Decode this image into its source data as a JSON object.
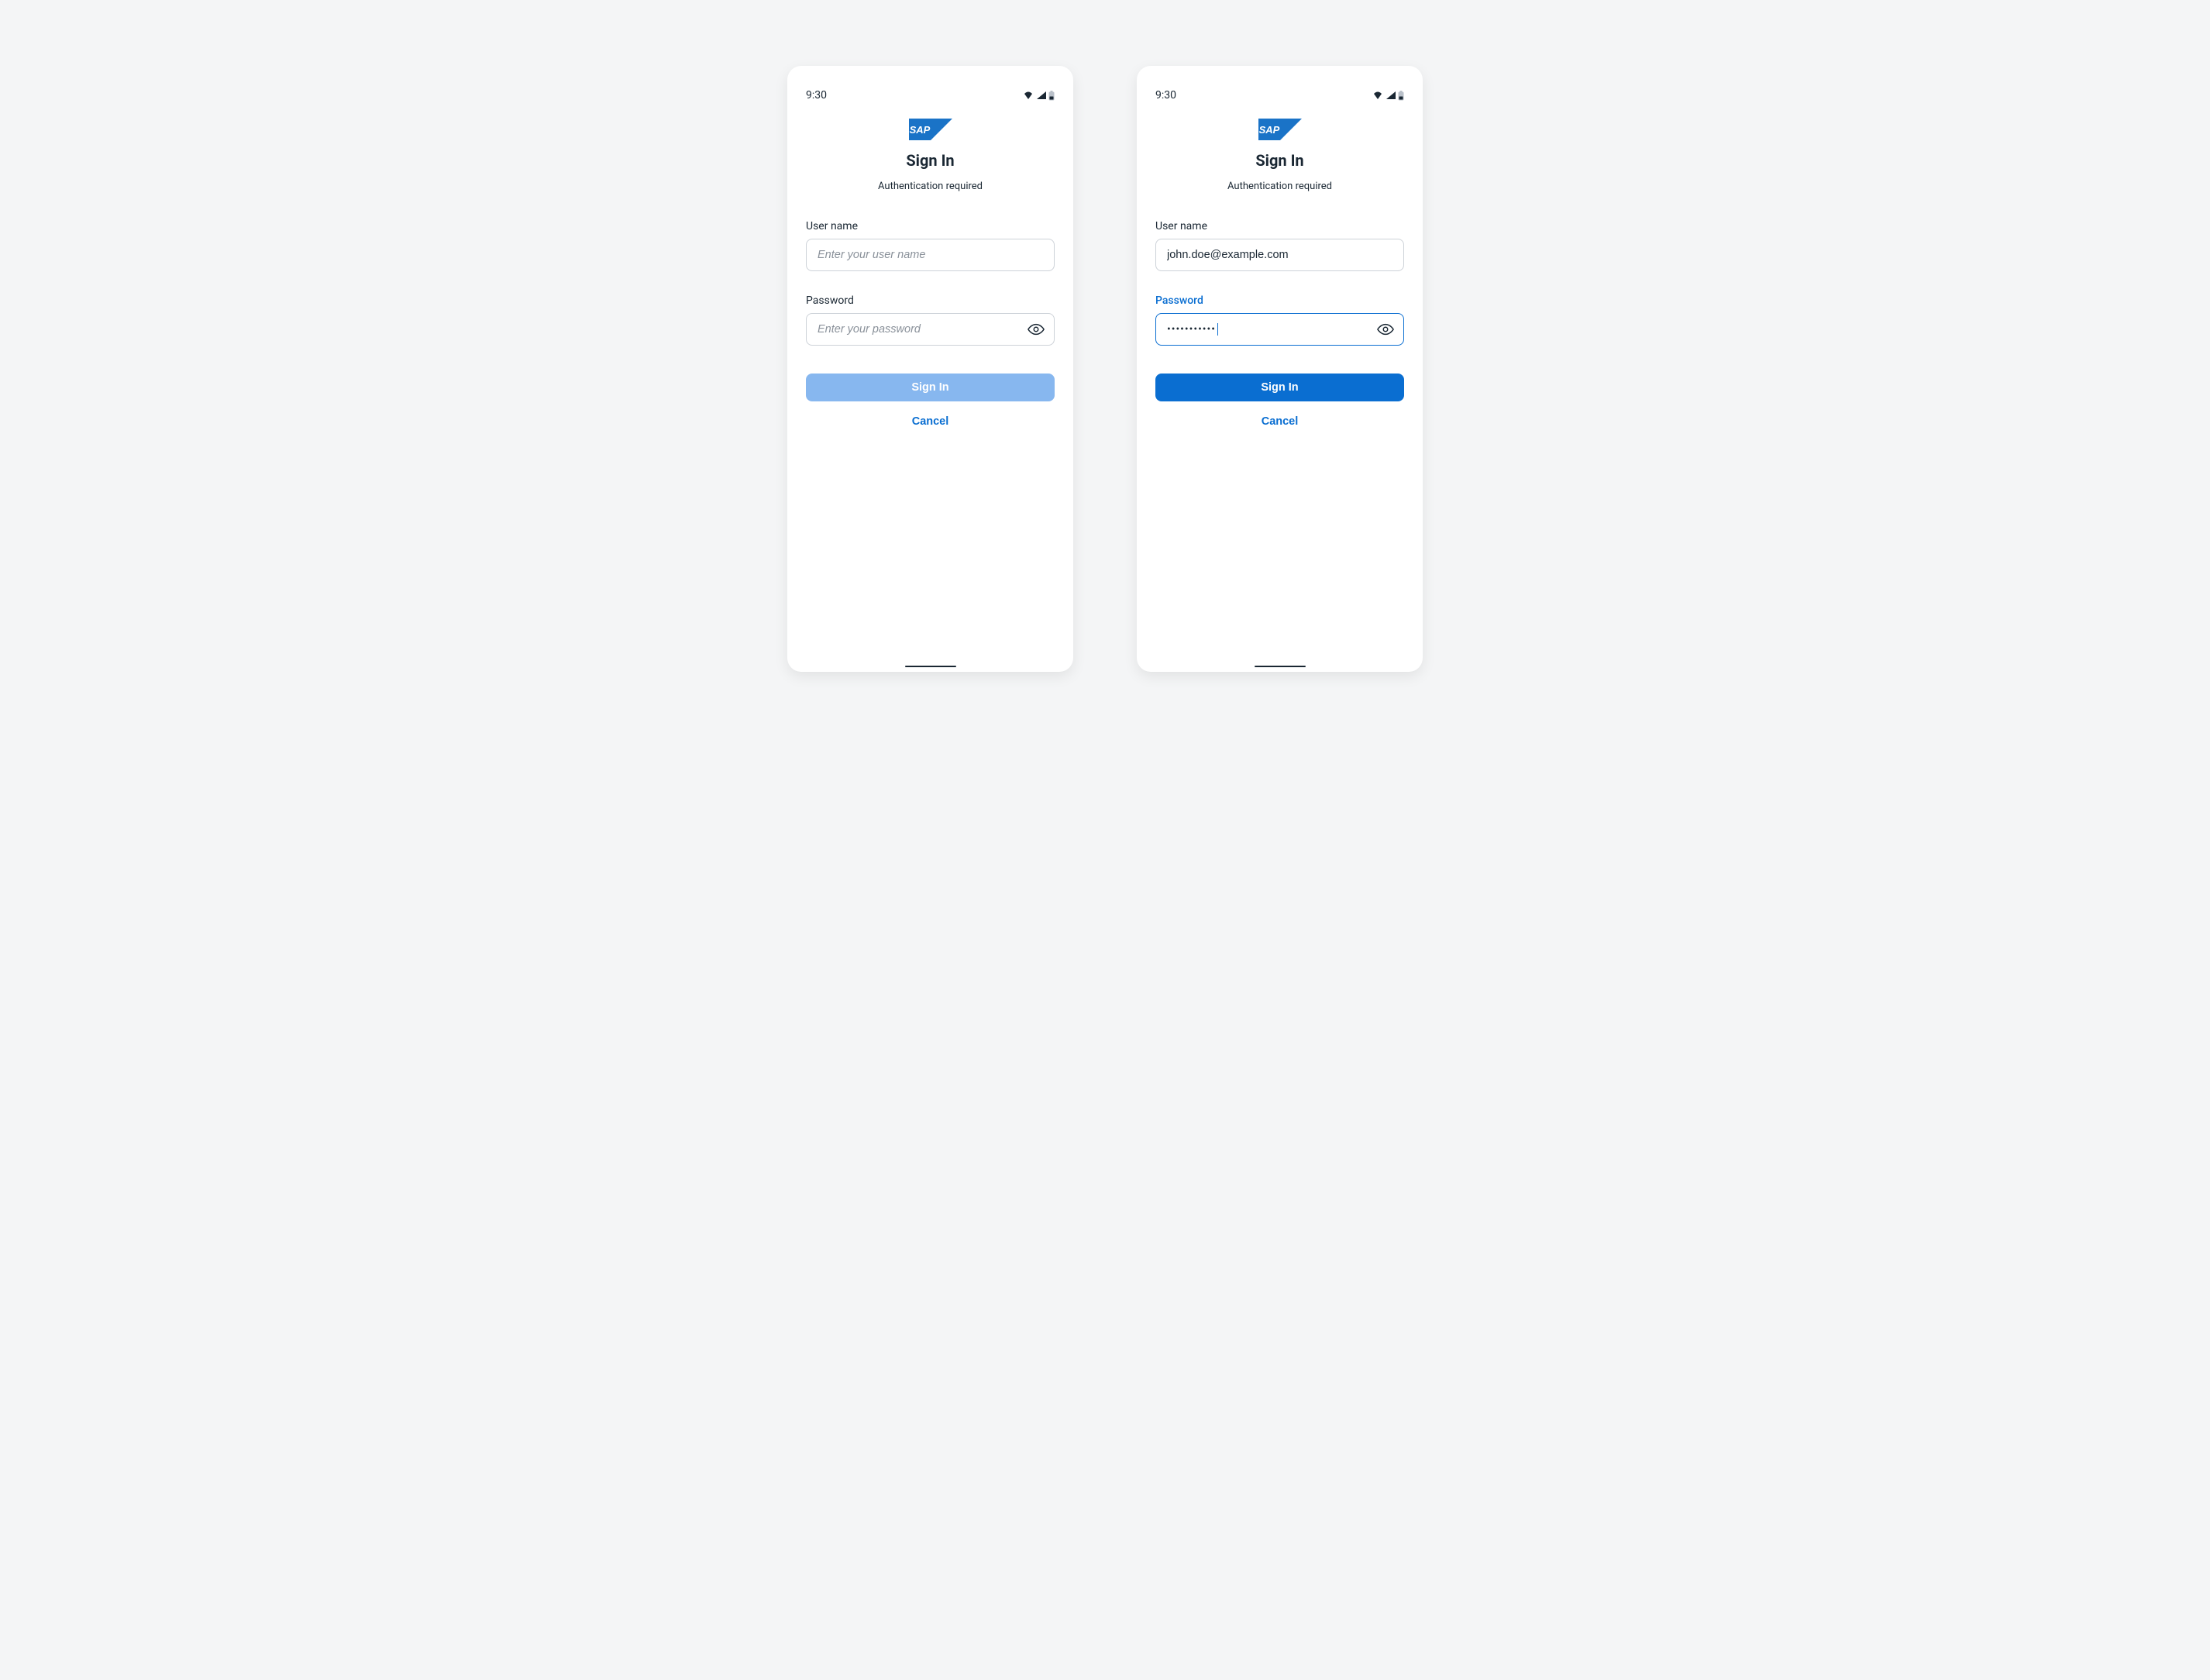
{
  "status": {
    "time": "9:30"
  },
  "screen1": {
    "title": "Sign In",
    "subtitle": "Authentication required",
    "username_label": "User name",
    "username_placeholder": "Enter your user name",
    "username_value": "",
    "password_label": "Password",
    "password_placeholder": "Enter your password",
    "password_value": "",
    "signin_button": "Sign In",
    "cancel_button": "Cancel"
  },
  "screen2": {
    "title": "Sign In",
    "subtitle": "Authentication required",
    "username_label": "User name",
    "username_value": "john.doe@example.com",
    "password_label": "Password",
    "password_masked": "•••••••••••",
    "signin_button": "Sign In",
    "cancel_button": "Cancel"
  }
}
